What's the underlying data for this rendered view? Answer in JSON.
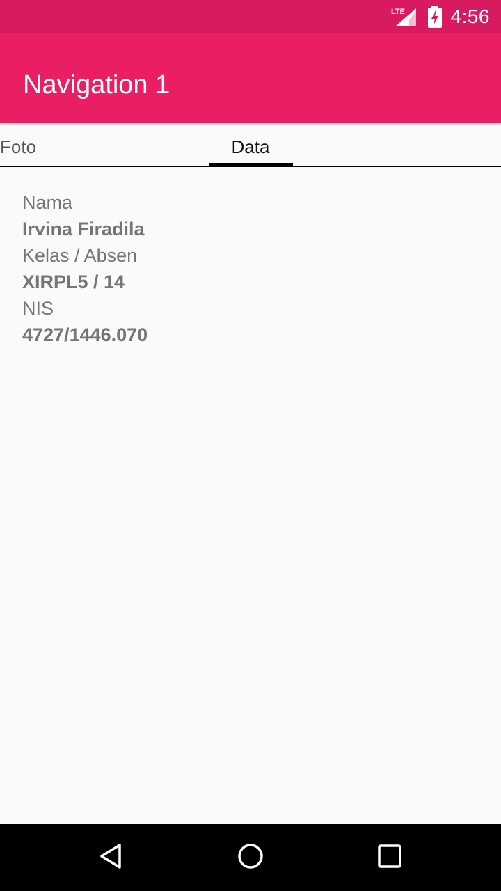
{
  "status_bar": {
    "network": "LTE",
    "time": "4:56",
    "icons": [
      "lte-signal-icon",
      "battery-charging-icon"
    ]
  },
  "app_bar": {
    "title": "Navigation 1",
    "color": "#e91e63",
    "status_color": "#d81b60"
  },
  "tabs": [
    {
      "label": "Foto",
      "selected": false
    },
    {
      "label": "Data",
      "selected": true
    }
  ],
  "profile": {
    "name_label": "Nama",
    "name_value": "Irvina Firadila",
    "class_label": "Kelas / Absen",
    "class_value": "XIRPL5 / 14",
    "nis_label": "NIS",
    "nis_value": "4727/1446.070"
  },
  "nav_bar": {
    "icons": [
      "back-icon",
      "home-icon",
      "recents-icon"
    ]
  }
}
